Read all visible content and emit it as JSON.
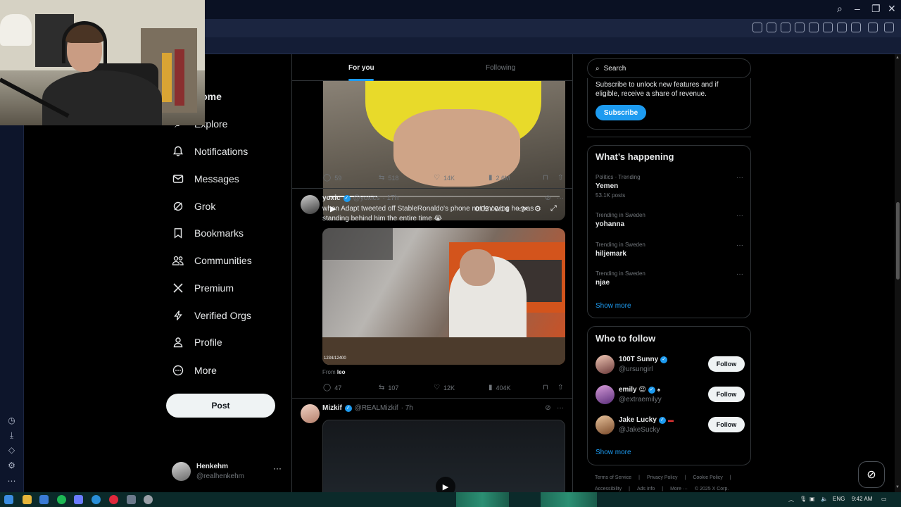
{
  "colors": {
    "accent": "#1d9bf0",
    "background": "#000000",
    "text_primary": "#e7e9ea",
    "text_secondary": "#71767b",
    "border": "#2f3336",
    "browser_toolbar": "#1b2540"
  },
  "nav": {
    "items": [
      {
        "label": "Home",
        "icon": "home-icon"
      },
      {
        "label": "Explore",
        "icon": "search-icon"
      },
      {
        "label": "Notifications",
        "icon": "bell-icon"
      },
      {
        "label": "Messages",
        "icon": "envelope-icon"
      },
      {
        "label": "Grok",
        "icon": "grok-icon"
      },
      {
        "label": "Bookmarks",
        "icon": "bookmark-icon"
      },
      {
        "label": "Communities",
        "icon": "people-icon"
      },
      {
        "label": "Premium",
        "icon": "x-logo-icon"
      },
      {
        "label": "Verified Orgs",
        "icon": "lightning-icon"
      },
      {
        "label": "Profile",
        "icon": "person-icon"
      },
      {
        "label": "More",
        "icon": "more-circle-icon"
      }
    ],
    "post_button": "Post",
    "account": {
      "name": "Henkehm",
      "handle": "@realhenkehm",
      "more": "···"
    }
  },
  "timeline": {
    "tabs": {
      "for_you": "For you",
      "following": "Following"
    },
    "video1": {
      "time": "0:03 / 0:14",
      "progress": 0.21
    },
    "post1_stats": {
      "replies": "59",
      "reposts": "518",
      "likes": "14K",
      "views": "2.6M"
    },
    "post2": {
      "name": "yoxic",
      "handle": "@yoxics",
      "time": "· 17h",
      "text": "when Adapt tweeted off StableRonaldo's phone not knowing he was standing behind him the entire time 😭",
      "counter": "1234/12400",
      "from_label": "From",
      "from_user": "leo",
      "stats": {
        "replies": "47",
        "reposts": "107",
        "likes": "12K",
        "views": "404K"
      }
    },
    "post3": {
      "name": "Mizkif",
      "handle": "@REALMizkif",
      "time": "· 7h"
    }
  },
  "right": {
    "search_placeholder": "Search",
    "premium": {
      "text": "Subscribe to unlock new features and if eligible, receive a share of revenue.",
      "button": "Subscribe"
    },
    "happening": {
      "title": "What’s happening",
      "trends": [
        {
          "meta": "Politics · Trending",
          "name": "Yemen",
          "posts": "53.1K posts"
        },
        {
          "meta": "Trending in Sweden",
          "name": "yohanna",
          "posts": ""
        },
        {
          "meta": "Trending in Sweden",
          "name": "hiljemark",
          "posts": ""
        },
        {
          "meta": "Trending in Sweden",
          "name": "njae",
          "posts": ""
        }
      ],
      "show_more": "Show more"
    },
    "who_to_follow": {
      "title": "Who to follow",
      "users": [
        {
          "name": "100T Sunny",
          "handle": "@ursungirl",
          "extra": ""
        },
        {
          "name": "emily 😌",
          "handle": "@extraemilyy",
          "extra": "♠"
        },
        {
          "name": "Jake Lucky",
          "handle": "@JakeSucky",
          "extra": "▬"
        }
      ],
      "follow_label": "Follow",
      "show_more": "Show more"
    },
    "footer": {
      "row1": [
        "Terms of Service",
        "|",
        "Privacy Policy",
        "|",
        "Cookie Policy",
        "|"
      ],
      "row2": [
        "Accessibility",
        "|",
        "Ads info",
        "|",
        "More ···",
        "© 2025 X Corp."
      ]
    }
  },
  "taskbar": {
    "lang": "ENG",
    "clock": "9:42 AM"
  }
}
